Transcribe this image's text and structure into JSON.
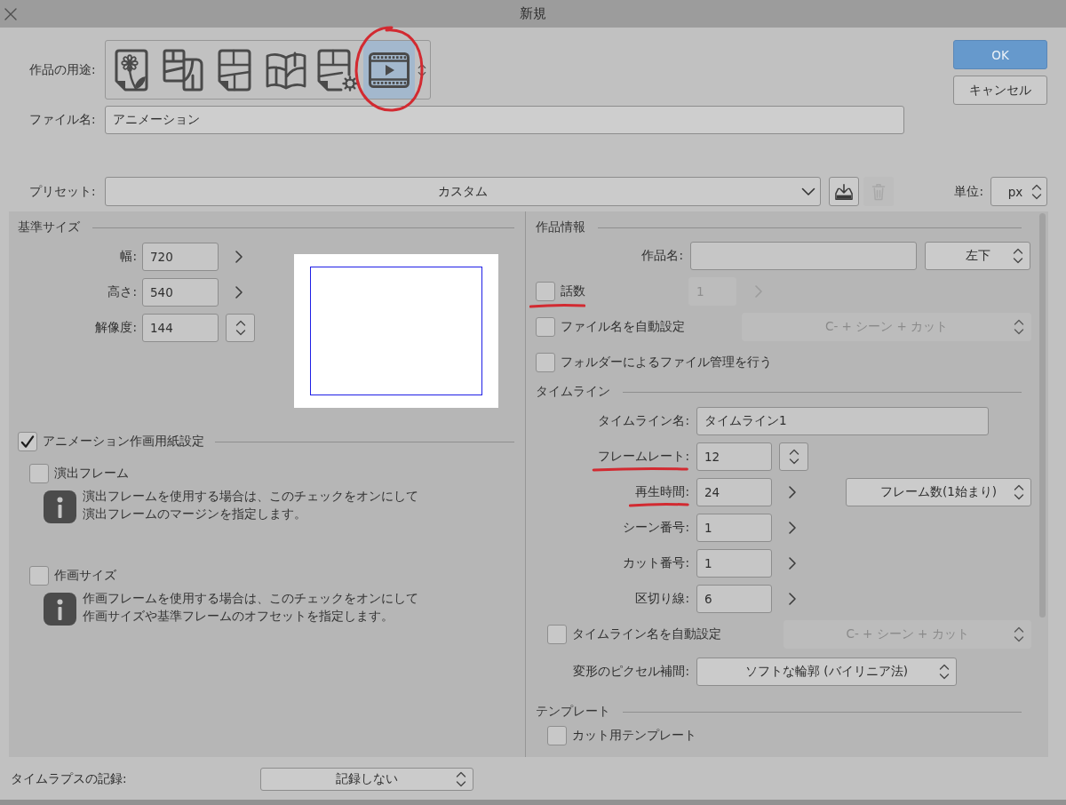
{
  "window": {
    "title": "新規"
  },
  "purpose": {
    "label": "作品の用途:",
    "items": [
      {
        "kind": "illustration",
        "selected": false,
        "circled": false
      },
      {
        "kind": "webtoon",
        "selected": false,
        "circled": false
      },
      {
        "kind": "comic",
        "selected": false,
        "circled": false
      },
      {
        "kind": "book",
        "selected": false,
        "circled": false
      },
      {
        "kind": "comic_settings",
        "selected": false,
        "circled": false
      },
      {
        "kind": "animation",
        "selected": true,
        "circled": true
      }
    ]
  },
  "file_name": {
    "label": "ファイル名:",
    "value": "アニメーション"
  },
  "buttons": [
    {
      "label": "OK",
      "kind": "primary"
    },
    {
      "label": "キャンセル",
      "kind": "secondary"
    }
  ],
  "preset": {
    "label": "プリセット:",
    "value": "カスタム",
    "delete_disabled": true
  },
  "unit": {
    "label": "単位:",
    "value": "px"
  },
  "base_size": {
    "title": "基準サイズ",
    "fields": [
      {
        "label": "幅:",
        "value": "720",
        "kind": "chevron"
      },
      {
        "label": "高さ:",
        "value": "540",
        "kind": "chevron"
      },
      {
        "label": "解像度:",
        "value": "144",
        "kind": "spinner"
      }
    ]
  },
  "animation_paper": {
    "label": "アニメーション作画用紙設定",
    "checked": true,
    "options": [
      {
        "label": "演出フレーム",
        "checked": false,
        "info": [
          "演出フレームを使用する場合は、このチェックをオンにして",
          "演出フレームのマージンを指定します。"
        ]
      },
      {
        "label": "作画サイズ",
        "checked": false,
        "info": [
          "作画フレームを使用する場合は、このチェックをオンにして",
          "作画サイズや基準フレームのオフセットを指定します。"
        ]
      }
    ]
  },
  "work_info": {
    "title": "作品情報",
    "work_name": {
      "label": "作品名:",
      "position": "左下"
    },
    "options": [
      {
        "label": "話数",
        "checked": false,
        "kind": "number",
        "value": "1",
        "disabled": true,
        "underlined": true
      },
      {
        "label": "ファイル名を自動設定",
        "checked": false,
        "kind": "format",
        "value": "C- + シーン + カット",
        "disabled": true,
        "underlined": false
      },
      {
        "label": "フォルダーによるファイル管理を行う",
        "checked": false,
        "kind": "plain",
        "underlined": false
      }
    ]
  },
  "timeline": {
    "title": "タイムライン",
    "fields": [
      {
        "label": "タイムライン名:",
        "value": "タイムライン1",
        "kind": "text",
        "underlined": false
      },
      {
        "label": "フレームレート:",
        "value": "12",
        "kind": "spinner",
        "underlined": true
      },
      {
        "label": "再生時間:",
        "value": "24",
        "kind": "chevron",
        "underlined": true,
        "mode": "フレーム数(1始まり)"
      },
      {
        "label": "シーン番号:",
        "value": "1",
        "kind": "chevron",
        "underlined": false
      },
      {
        "label": "カット番号:",
        "value": "1",
        "kind": "chevron",
        "underlined": false
      },
      {
        "label": "区切り線:",
        "value": "6",
        "kind": "chevron",
        "underlined": false
      }
    ],
    "auto_name": {
      "label": "タイムライン名を自動設定",
      "checked": false,
      "value": "C- + シーン + カット",
      "disabled": true
    },
    "interpolation": {
      "label": "変形のピクセル補間:",
      "value": "ソフトな輪郭 (バイリニア法)"
    }
  },
  "template": {
    "title": "テンプレート",
    "options": [
      {
        "label": "カット用テンプレート",
        "checked": false
      }
    ]
  },
  "timelapse": {
    "label": "タイムラプスの記録:",
    "value": "記録しない"
  }
}
